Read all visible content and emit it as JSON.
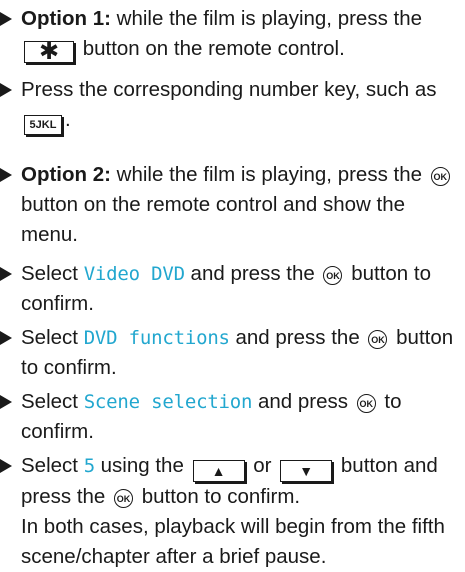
{
  "steps": [
    {
      "bold": "Option 1:",
      "pre": " while the film is playing, press the",
      "key": "✱",
      "post": "button on the remote control."
    },
    {
      "pre": "Press the corresponding number key, such as",
      "key": "5JKL",
      "post": "."
    },
    {
      "bold": "Option 2:",
      "pre": " while the film is playing, press the",
      "ok": "OK",
      "post": "button on the remote control and show the menu."
    },
    {
      "pre": "Select",
      "display": "Video DVD",
      "mid": "and press the",
      "ok": "OK",
      "post": "button to confirm."
    },
    {
      "pre": "Select",
      "display": "DVD functions",
      "mid": "and press the",
      "ok": "OK",
      "post": "button to confirm."
    },
    {
      "pre": "Select",
      "display": "Scene selection",
      "mid": "and press",
      "ok": "OK",
      "post": "to confirm."
    },
    {
      "pre": "Select",
      "display": "5",
      "mid": "using the",
      "key_up": "▲",
      "or": "or",
      "key_down": "▼",
      "mid2": "button and press the",
      "ok": "OK",
      "post": "button to confirm."
    }
  ],
  "note": "In both cases, playback will begin from the fifth scene/chapter after a brief pause."
}
